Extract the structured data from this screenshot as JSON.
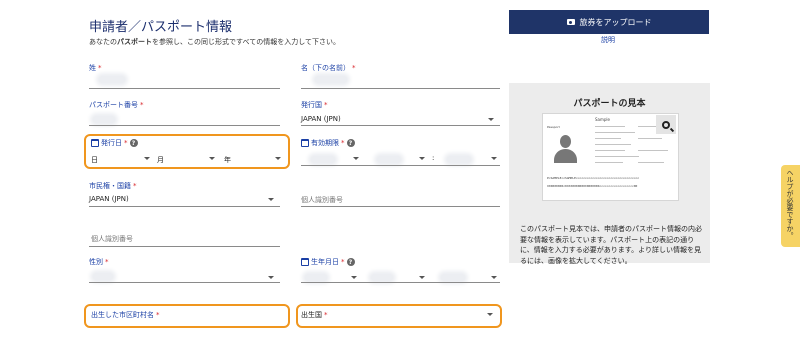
{
  "header": {
    "title": "申請者／パスポート情報",
    "subtitle_before": "あなたの",
    "subtitle_bold": "パスポート",
    "subtitle_after": "を参照し、この同じ形式ですべての情報を入力して下さい。"
  },
  "required_mark": "*",
  "form": {
    "surname_label": "姓",
    "given_names_label": "名（下の名前）",
    "passport_number_label": "パスポート番号",
    "issuing_country_label": "発行国",
    "issuing_country_value": "JAPAN (JPN)",
    "issue_date_label": "発行日",
    "issue_date_day": "日",
    "issue_date_month": "月",
    "issue_date_year": "年",
    "expiry_date_label": "有効期限",
    "expiry_separator": ":",
    "nationality_label": "市民権・国籍",
    "nationality_value": "JAPAN (JPN)",
    "national_id_placeholder": "個人識別番号",
    "national_id_placeholder_2": "個人識別番号",
    "sex_label": "性別",
    "dob_label": "生年月日",
    "birth_city_label": "出生した市区町村名",
    "birth_country_label": "出生国"
  },
  "sidebar": {
    "upload_label": "旅券をアップロード",
    "explain_link": "説明",
    "sample_title": "パスポートの見本",
    "sample_description": "このパスポート見本では、申請者のパスポート情報の内必要な情報を表示しています。パスポート上の表記の通りに、情報を入力する必要があります。より詳しい情報を見るには、画像を拡大してください。",
    "passport_sample_word": "Sample",
    "passport_type_word": "Passport",
    "mrz_line_1": "P<SAMPLE<<SAMPLE<<<<<<<<<<<<<<<<<<<<<<<<<<<<<<<<<<<",
    "mrz_line_2": "XX0000000<0XXX0000000X0000000<<<<<<<<<<<<<<<<<<<00"
  },
  "help_tab": {
    "label": "ヘルプが必要ですか。"
  },
  "colors": {
    "accent": "#1a3fa5",
    "highlight": "#f0961e",
    "button": "#1f3468",
    "required": "#d9252a"
  }
}
